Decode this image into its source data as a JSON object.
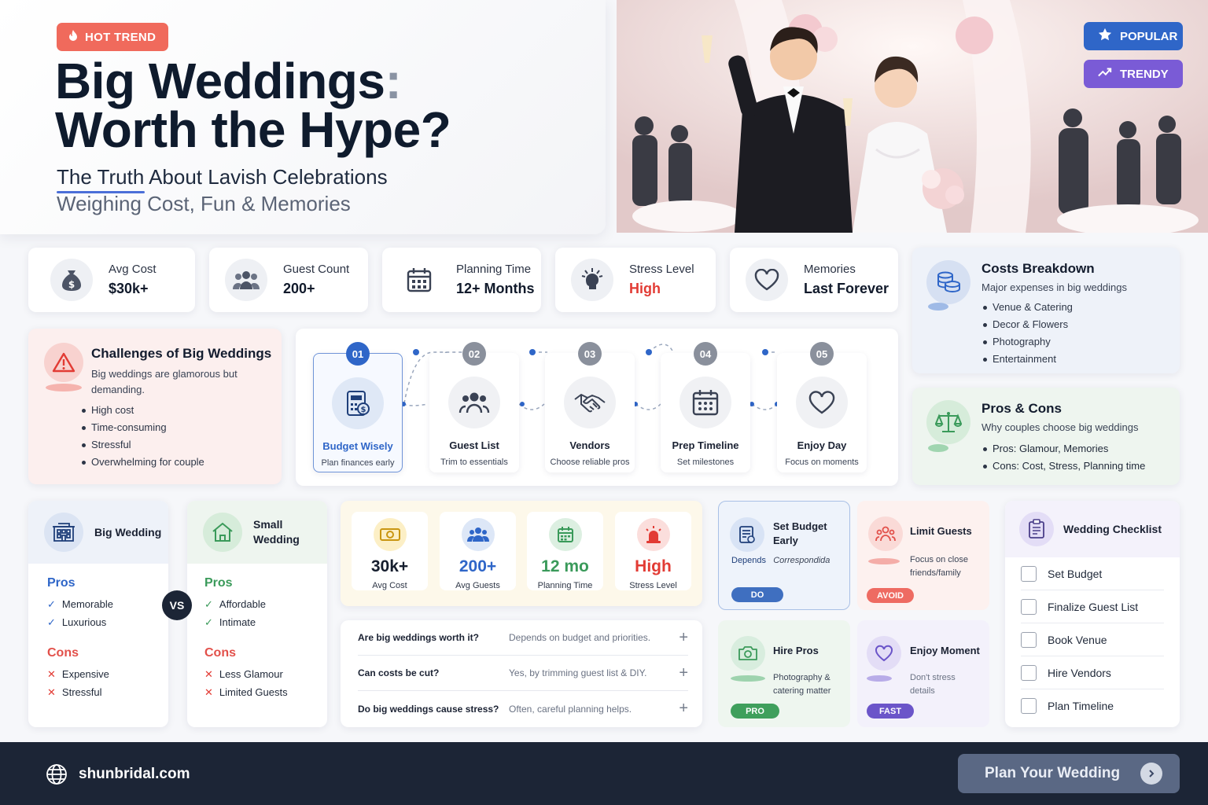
{
  "hero": {
    "badge": "HOT TREND",
    "title_line1": "Big Weddings",
    "title_colon": ":",
    "title_line2": "Worth the Hype?",
    "subtitle": "The Truth About Lavish Celebrations",
    "tagline": "Weighing Cost, Fun & Memories"
  },
  "badges": {
    "popular": "POPULAR",
    "trendy": "TRENDY"
  },
  "stats": [
    {
      "label": "Avg Cost",
      "value": "$30k+"
    },
    {
      "label": "Guest Count",
      "value": "200+"
    },
    {
      "label": "Planning Time",
      "value": "12+ Months"
    },
    {
      "label": "Stress Level",
      "value": "High"
    },
    {
      "label": "Memories",
      "value": "Last Forever"
    }
  ],
  "costs": {
    "title": "Costs Breakdown",
    "subtitle": "Major expenses in big weddings",
    "items": [
      "Venue & Catering",
      "Decor & Flowers",
      "Photography",
      "Entertainment"
    ]
  },
  "proscons": {
    "title": "Pros & Cons",
    "subtitle": "Why couples choose big weddings",
    "pros": "Pros: Glamour, Memories",
    "cons": "Cons: Cost, Stress, Planning time"
  },
  "challenges": {
    "title": "Challenges of Big Weddings",
    "desc_line1": "Big weddings are glamorous but",
    "desc_line2": "demanding.",
    "items": [
      "High cost",
      "Time-consuming",
      "Stressful",
      "Overwhelming for couple"
    ]
  },
  "steps": [
    {
      "num": "01",
      "title": "Budget Wisely",
      "desc": "Plan finances early"
    },
    {
      "num": "02",
      "title": "Guest List",
      "desc": "Trim to essentials"
    },
    {
      "num": "03",
      "title": "Vendors",
      "desc": "Choose reliable pros"
    },
    {
      "num": "04",
      "title": "Prep Timeline",
      "desc": "Set milestones"
    },
    {
      "num": "05",
      "title": "Enjoy Day",
      "desc": "Focus on moments"
    }
  ],
  "big": {
    "title": "Big Wedding",
    "pros_label": "Pros",
    "pros": [
      "Memorable",
      "Luxurious"
    ],
    "cons_label": "Cons",
    "cons": [
      "Expensive",
      "Stressful"
    ]
  },
  "vs": "VS",
  "small": {
    "title_line1": "Small",
    "title_line2": "Wedding",
    "pros_label": "Pros",
    "pros": [
      "Affordable",
      "Intimate"
    ],
    "cons_label": "Cons",
    "cons": [
      "Less Glamour",
      "Limited Guests"
    ]
  },
  "mini_stats": [
    {
      "value": "30k+",
      "label": "Avg Cost"
    },
    {
      "value": "200+",
      "label": "Avg Guests"
    },
    {
      "value": "12 mo",
      "label": "Planning Time"
    },
    {
      "value": "High",
      "label": "Stress Level"
    }
  ],
  "faq": [
    {
      "q": "Are big weddings worth it?",
      "a": "Depends on budget and priorities."
    },
    {
      "q": "Can costs be cut?",
      "a": "Yes, by trimming guest list & DIY."
    },
    {
      "q": "Do big weddings cause stress?",
      "a": "Often, careful planning helps."
    }
  ],
  "tips": {
    "budget": {
      "title_line1": "Set Budget",
      "title_line2": "Early",
      "desc": "Depends",
      "desc2": "Correspondida",
      "tag": "DO"
    },
    "limit": {
      "title": "Limit Guests",
      "desc_line1": "Focus on close",
      "desc_line2": "friends/family",
      "tag": "AVOID"
    },
    "hire": {
      "title": "Hire Pros",
      "desc_line1": "Photography &",
      "desc_line2": "catering matter",
      "tag": "PRO"
    },
    "enjoy": {
      "title": "Enjoy Moment",
      "desc_line1": "Don't stress",
      "desc_line2": "details",
      "tag": "FAST"
    }
  },
  "checklist": {
    "title": "Wedding Checklist",
    "items": [
      "Set Budget",
      "Finalize Guest List",
      "Book Venue",
      "Hire Vendors",
      "Plan Timeline"
    ]
  },
  "footer": {
    "site": "shunbridal.com",
    "cta": "Plan Your Wedding"
  },
  "colors": {
    "accent_blue": "#2f66c8",
    "coral": "#f06a5c",
    "green": "#3a9a5a",
    "red": "#e23b34",
    "purple": "#6b55c9",
    "navy": "#1c2536"
  }
}
